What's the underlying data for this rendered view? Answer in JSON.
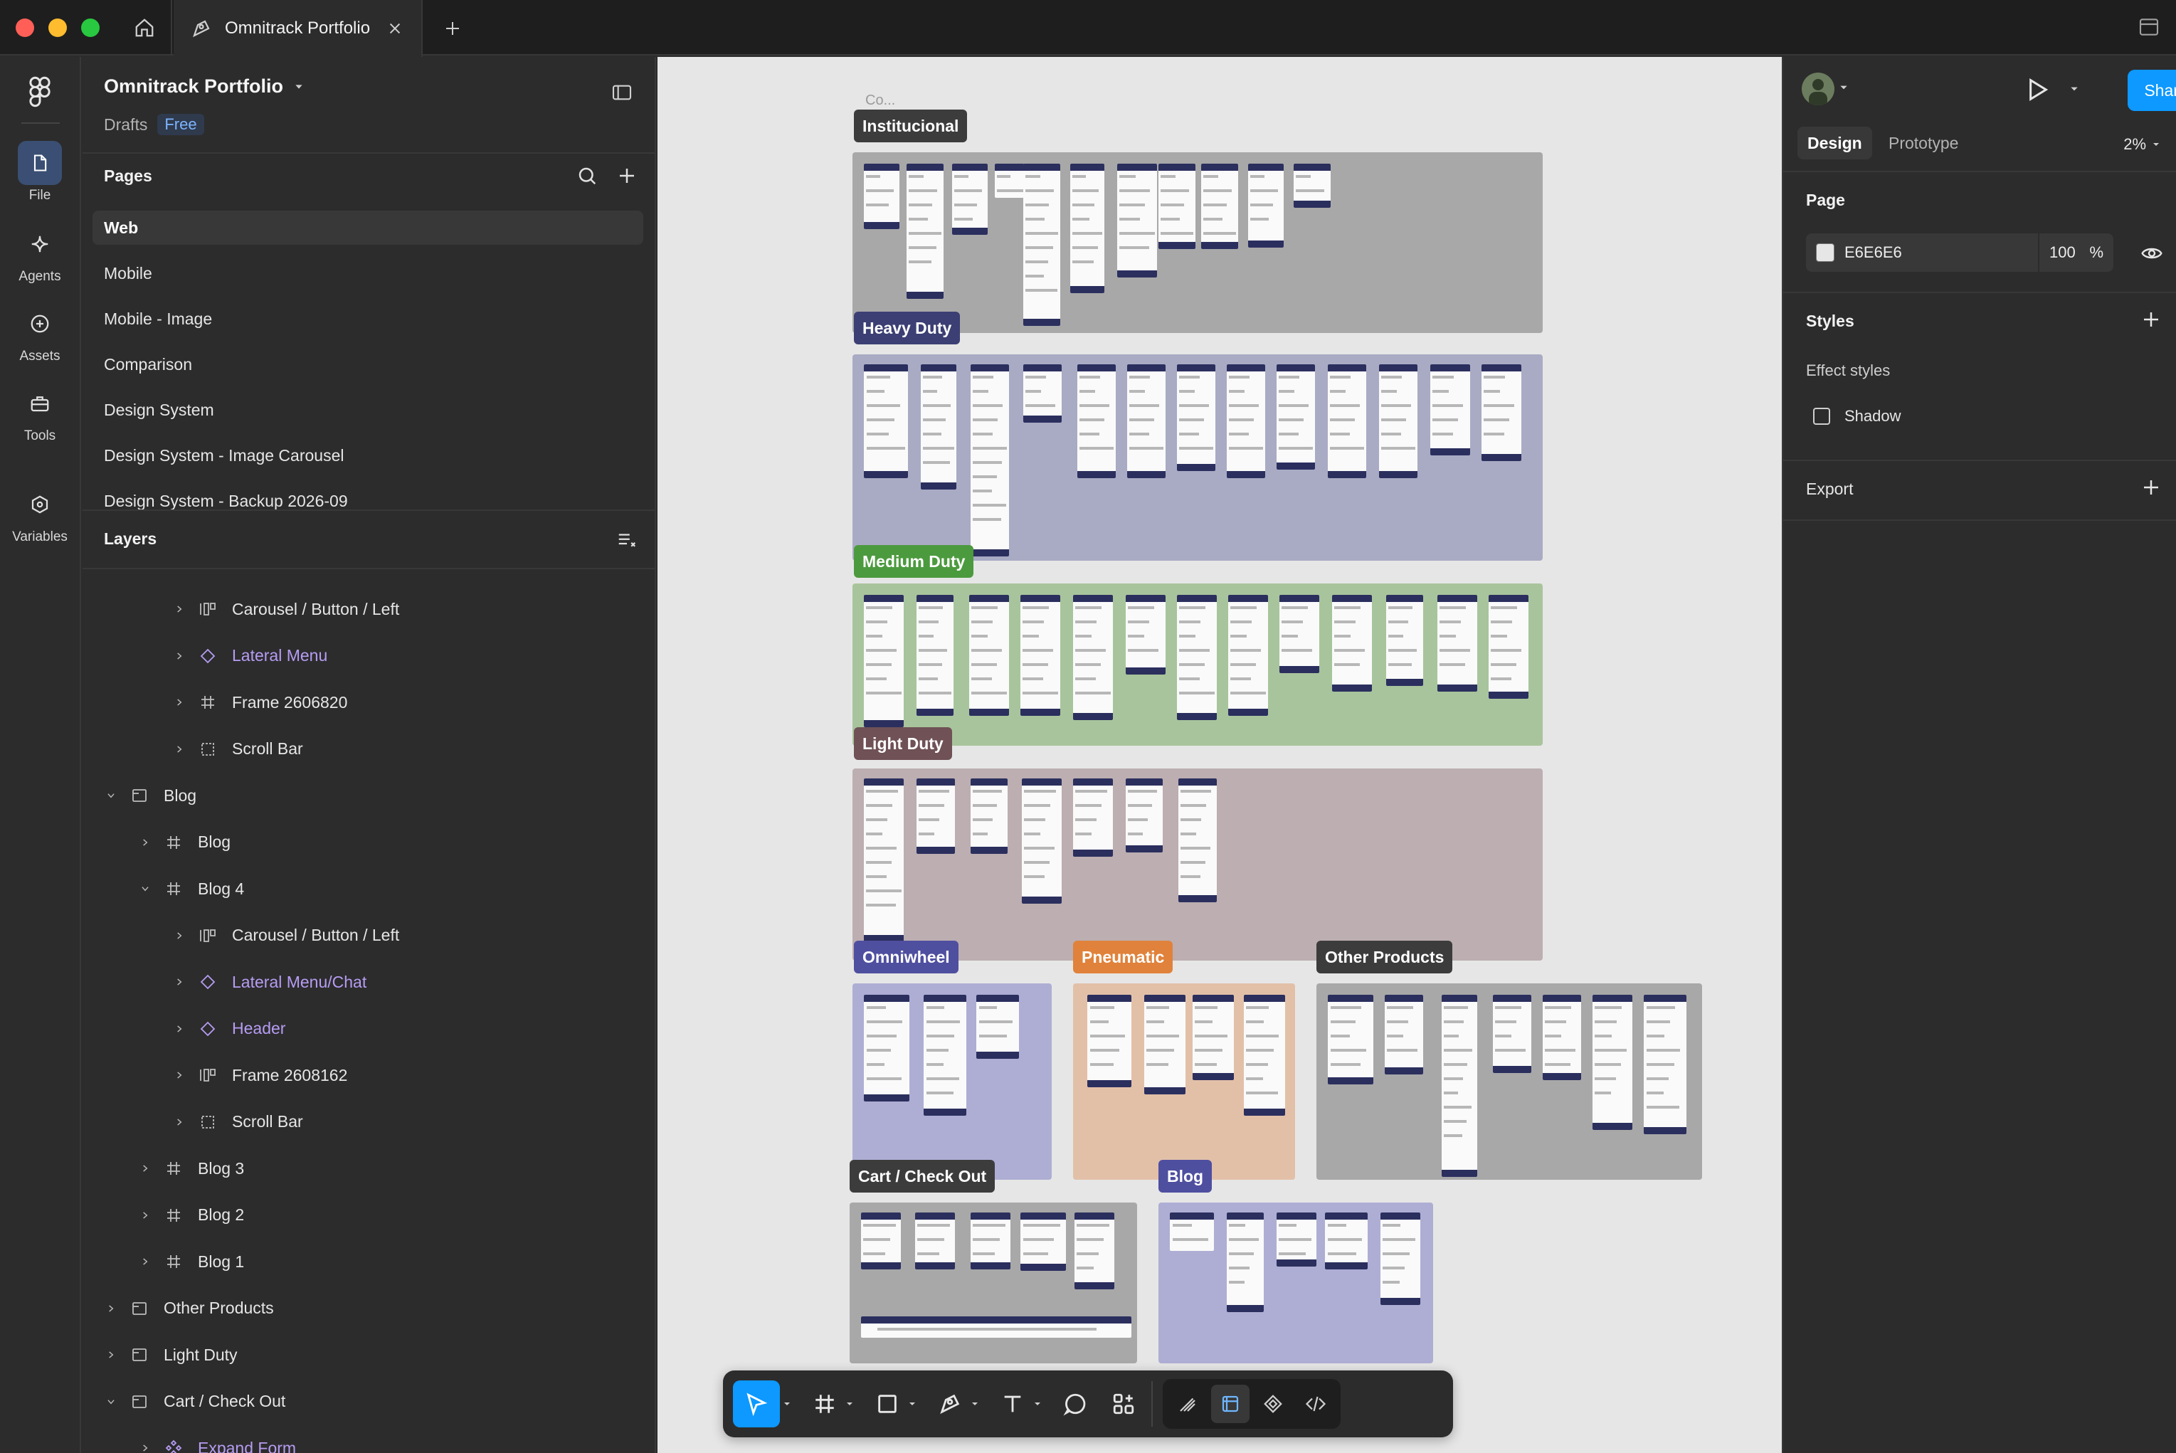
{
  "titlebar": {
    "tab_title": "Omnitrack Portfolio"
  },
  "rail": {
    "items": [
      {
        "label": "File",
        "icon": "file-icon"
      },
      {
        "label": "Agents",
        "icon": "sparkle-icon"
      },
      {
        "label": "Assets",
        "icon": "assets-icon"
      },
      {
        "label": "Tools",
        "icon": "toolbox-icon"
      },
      {
        "label": "Variables",
        "icon": "variables-icon"
      }
    ]
  },
  "left_panel": {
    "file_name": "Omnitrack Portfolio",
    "location": "Drafts",
    "plan_badge": "Free",
    "pages_heading": "Pages",
    "pages": [
      {
        "label": "Web",
        "active": true
      },
      {
        "label": "Mobile"
      },
      {
        "label": "Mobile - Image"
      },
      {
        "label": "Comparison"
      },
      {
        "label": "Design System"
      },
      {
        "label": "Design System - Image Carousel"
      },
      {
        "label": "Design System - Backup 2026-09"
      }
    ],
    "layers_heading": "Layers",
    "layers": [
      {
        "label": "Carousel / Button / Left",
        "depth": 2,
        "icon": "auto-layout-icon",
        "expanded": false,
        "component": false
      },
      {
        "label": "Lateral Menu",
        "depth": 2,
        "icon": "component-instance-icon",
        "expanded": false,
        "component": true
      },
      {
        "label": "Frame 2606820",
        "depth": 2,
        "icon": "frame-icon",
        "expanded": false,
        "component": false
      },
      {
        "label": "Scroll Bar",
        "depth": 2,
        "icon": "group-icon",
        "expanded": false,
        "component": false
      },
      {
        "label": "Blog",
        "depth": 0,
        "icon": "section-icon",
        "expanded": true,
        "component": false
      },
      {
        "label": "Blog",
        "depth": 1,
        "icon": "frame-icon",
        "expanded": false,
        "component": false
      },
      {
        "label": "Blog 4",
        "depth": 1,
        "icon": "frame-icon",
        "expanded": true,
        "component": false
      },
      {
        "label": "Carousel / Button / Left",
        "depth": 2,
        "icon": "auto-layout-icon",
        "expanded": false,
        "component": false
      },
      {
        "label": "Lateral Menu/Chat",
        "depth": 2,
        "icon": "component-instance-icon",
        "expanded": false,
        "component": true
      },
      {
        "label": "Header",
        "depth": 2,
        "icon": "component-instance-icon",
        "expanded": false,
        "component": true
      },
      {
        "label": "Frame 2608162",
        "depth": 2,
        "icon": "auto-layout-icon",
        "expanded": false,
        "component": false
      },
      {
        "label": "Scroll Bar",
        "depth": 2,
        "icon": "group-icon",
        "expanded": false,
        "component": false
      },
      {
        "label": "Blog 3",
        "depth": 1,
        "icon": "frame-icon",
        "expanded": false,
        "component": false
      },
      {
        "label": "Blog 2",
        "depth": 1,
        "icon": "frame-icon",
        "expanded": false,
        "component": false
      },
      {
        "label": "Blog 1",
        "depth": 1,
        "icon": "frame-icon",
        "expanded": false,
        "component": false
      },
      {
        "label": "Other Products",
        "depth": 0,
        "icon": "section-icon",
        "expanded": false,
        "component": false
      },
      {
        "label": "Light Duty",
        "depth": 0,
        "icon": "section-icon",
        "expanded": false,
        "component": false
      },
      {
        "label": "Cart / Check Out",
        "depth": 0,
        "icon": "section-icon",
        "expanded": true,
        "component": false
      },
      {
        "label": "Expand Form",
        "depth": 1,
        "icon": "component-set-icon",
        "expanded": false,
        "component": true
      }
    ]
  },
  "canvas": {
    "background": "#E6E6E6",
    "ghost_label": "Co...",
    "sections": [
      {
        "label": "Institucional",
        "label_color": "#3c3c3c",
        "fill": "#a8a8a8"
      },
      {
        "label": "Heavy Duty",
        "label_color": "#3b3f73",
        "fill": "#a9abc4"
      },
      {
        "label": "Medium Duty",
        "label_color": "#4c9a3e",
        "fill": "#a8c49c"
      },
      {
        "label": "Light Duty",
        "label_color": "#6f5156",
        "fill": "#bcaeb1"
      },
      {
        "label": "Omniwheel",
        "label_color": "#4f4fa0",
        "fill": "#aeaed4"
      },
      {
        "label": "Pneumatic",
        "label_color": "#e0823b",
        "fill": "#e2c0a8"
      },
      {
        "label": "Other Products",
        "label_color": "#3c3c3c",
        "fill": "#a8a8a8"
      },
      {
        "label": "Cart / Check Out",
        "label_color": "#3c3c3c",
        "fill": "#a8a8a8"
      },
      {
        "label": "Blog",
        "label_color": "#4f4fa0",
        "fill": "#aeaed4"
      }
    ]
  },
  "toolbar": {
    "tools": [
      "move-tool",
      "frame-tool",
      "shape-tool",
      "pen-tool",
      "text-tool",
      "comment-tool",
      "actions-tool"
    ],
    "active_tool": "move-tool",
    "dev_tools": [
      "draw-mode",
      "design-mode",
      "component-mode",
      "dev-mode"
    ],
    "accent": "#0d99ff"
  },
  "right_panel": {
    "share_label": "Share",
    "tabs": [
      {
        "label": "Design",
        "active": true
      },
      {
        "label": "Prototype"
      }
    ],
    "zoom": "2%",
    "page_heading": "Page",
    "page_fill_hex": "E6E6E6",
    "page_fill_opacity": "100",
    "opacity_unit": "%",
    "styles_heading": "Styles",
    "effect_styles_label": "Effect styles",
    "shadow_style": "Shadow",
    "export_heading": "Export"
  },
  "help_label": "?"
}
